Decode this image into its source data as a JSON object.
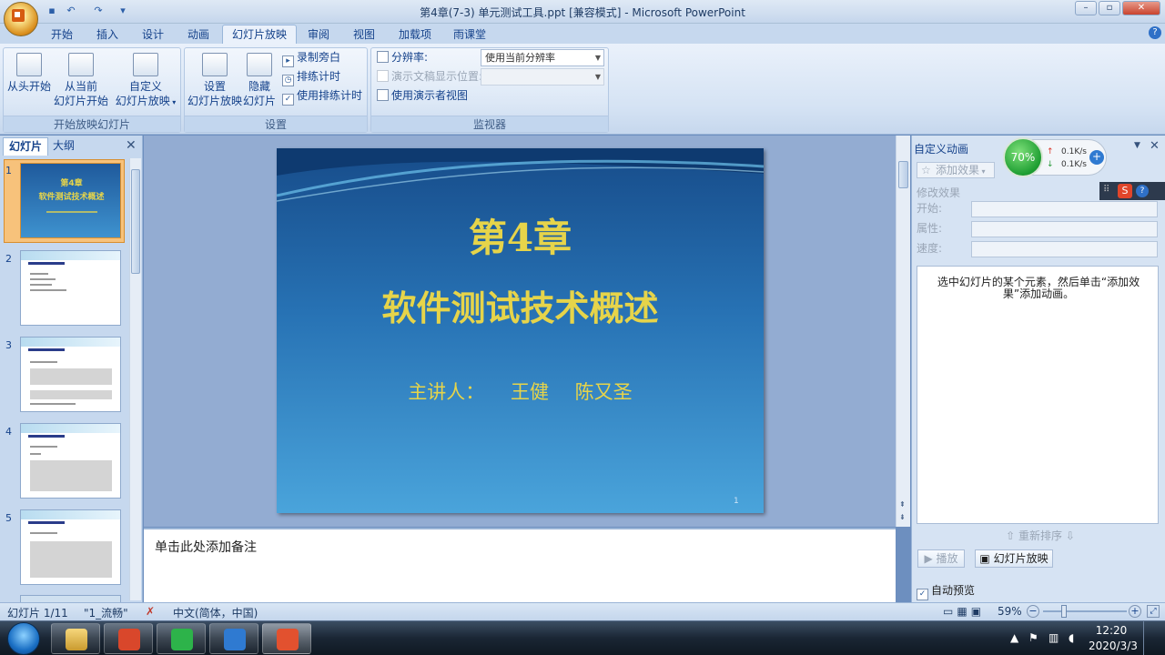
{
  "window": {
    "title": "第4章(7-3) 单元测试工具.ppt [兼容模式] - Microsoft PowerPoint"
  },
  "qat": {
    "save_icon": "save-icon",
    "undo_icon": "undo-icon",
    "redo_icon": "redo-icon",
    "customize_icon": "chevron-down-icon"
  },
  "tabs": [
    "开始",
    "插入",
    "设计",
    "动画",
    "幻灯片放映",
    "审阅",
    "视图",
    "加载项",
    "雨课堂"
  ],
  "active_tab": "幻灯片放映",
  "ribbon": {
    "group1": {
      "label": "开始放映幻灯片",
      "from_start_line1": "从头开始",
      "from_current_line1": "从当前",
      "from_current_line2": "幻灯片开始",
      "custom_line1": "自定义",
      "custom_line2": "幻灯片放映"
    },
    "group2": {
      "label": "设置",
      "setup_line1": "设置",
      "setup_line2": "幻灯片放映",
      "hide_line1": "隐藏",
      "hide_line2": "幻灯片",
      "record_narration": "录制旁白",
      "rehearse_timings": "排练计时",
      "use_rehearsed": "使用排练计时"
    },
    "group3": {
      "label": "监视器",
      "resolution_label": "分辨率:",
      "resolution_value": "使用当前分辨率",
      "show_on_label": "演示文稿显示位置:",
      "presenter_view": "使用演示者视图"
    }
  },
  "left_pane": {
    "tab_slides": "幻灯片",
    "tab_outline": "大纲",
    "slide_numbers": [
      "1",
      "2",
      "3",
      "4",
      "5"
    ],
    "thumb1_title": "第4章",
    "thumb1_sub": "软件测试技术概述"
  },
  "slide": {
    "title": "第4章",
    "subtitle": "软件测试技术概述",
    "presenter": "主讲人： 王健 陈又圣",
    "page_number": "1"
  },
  "notes": {
    "placeholder": "单击此处添加备注"
  },
  "right_pane": {
    "title": "自定义动画",
    "add_effect": "添加效果",
    "modify_effect": "修改效果",
    "start_label": "开始:",
    "property_label": "属性:",
    "speed_label": "速度:",
    "description": "选中幻灯片的某个元素，然后单击“添加效果”添加动画。",
    "reorder": "重新排序",
    "play": "播放",
    "slideshow": "幻灯片放映",
    "autopreview": "自动预览"
  },
  "net_widget": {
    "percent": "70%",
    "up": "0.1K/s",
    "down": "0.1K/s"
  },
  "statusbar": {
    "slide_info": "幻灯片 1/11",
    "theme": "\"1_流畅\"",
    "language": "中文(简体，中国)",
    "zoom": "59%"
  },
  "taskbar": {
    "time": "12:20",
    "date": "2020/3/3"
  }
}
